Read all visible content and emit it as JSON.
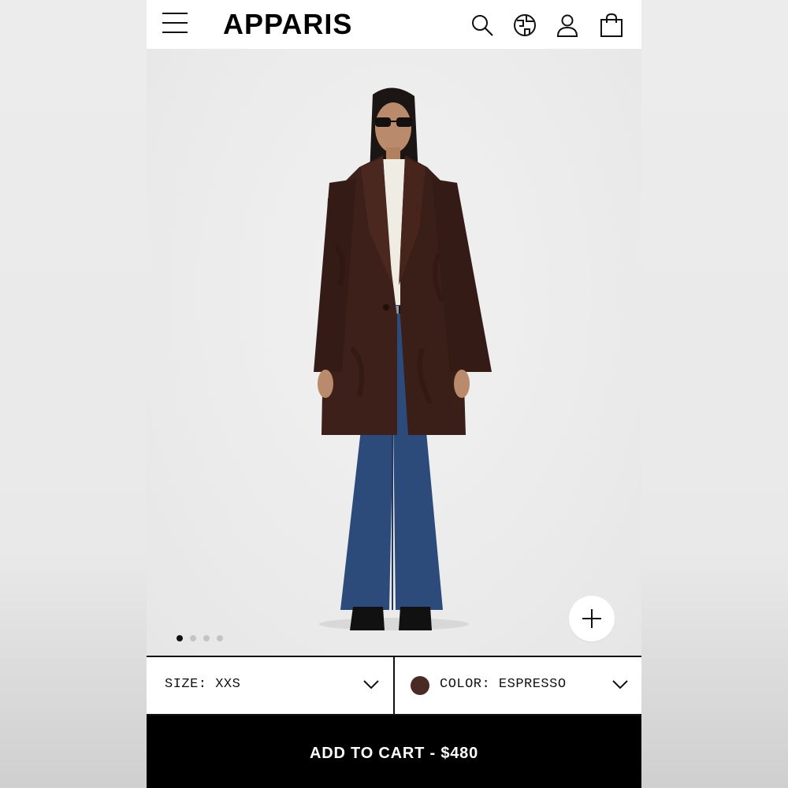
{
  "header": {
    "brand": "APPARIS",
    "icons": [
      "menu-icon",
      "search-icon",
      "globe-icon",
      "account-icon",
      "bag-icon"
    ]
  },
  "gallery": {
    "image_count": 4,
    "active_index": 0,
    "zoom_icon": "plus-icon"
  },
  "size_selector": {
    "label": "SIZE: XXS"
  },
  "color_selector": {
    "label": "COLOR: ESPRESSO",
    "swatch_color": "#4a2a24"
  },
  "cart": {
    "label": "ADD TO CART - $480"
  }
}
